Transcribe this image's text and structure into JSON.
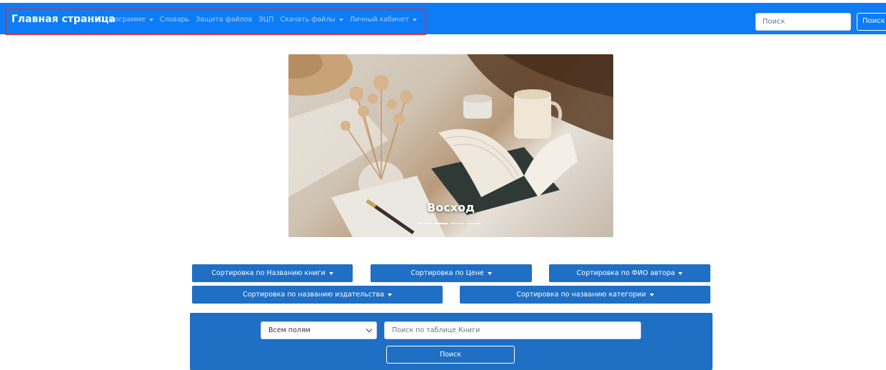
{
  "navbar": {
    "brand": "Главная страница",
    "items": [
      {
        "label": "О программе",
        "dropdown": true
      },
      {
        "label": "Словарь",
        "dropdown": false
      },
      {
        "label": "Защита файлов",
        "dropdown": false
      },
      {
        "label": "ЭЦП",
        "dropdown": false
      },
      {
        "label": "Скачать файлы",
        "dropdown": true
      },
      {
        "label": "Личный кабинет",
        "dropdown": true
      }
    ],
    "search_placeholder": "Поиск",
    "search_button": "Поиск",
    "colors": {
      "background": "#0d7cf6",
      "highlight_border": "#e03131"
    }
  },
  "carousel": {
    "caption": "Восход",
    "slide_count": 4,
    "active_index": 1
  },
  "sorting": {
    "by_title": "Сортировка по Названию книги",
    "by_price": "Сортировка по Цене",
    "by_author": "Сортировка по ФИО автора",
    "by_publisher": "Сортировка по названию издательства",
    "by_category": "Сортировка по названию категории",
    "button_color": "#1f6fc5"
  },
  "search_panel": {
    "field_select_value": "Всем полям",
    "table_search_placeholder": "Поиск по таблице Книги",
    "submit_label": "Поиск",
    "background": "#1f6fc5"
  }
}
